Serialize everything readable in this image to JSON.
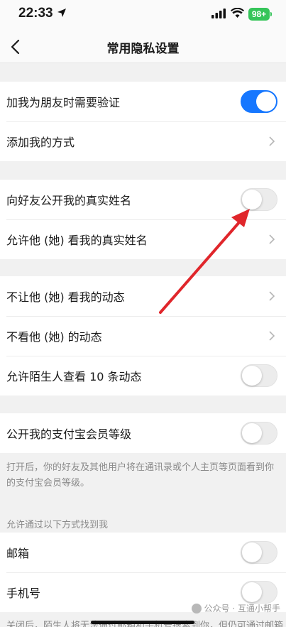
{
  "status_bar": {
    "time": "22:33",
    "battery": "98+"
  },
  "header": {
    "title": "常用隐私设置"
  },
  "groups": [
    {
      "rows": [
        {
          "label": "加我为朋友时需要验证",
          "control": "toggle",
          "on": true
        },
        {
          "label": "添加我的方式",
          "control": "chevron"
        }
      ]
    },
    {
      "rows": [
        {
          "label": "向好友公开我的真实姓名",
          "control": "toggle",
          "on": false
        },
        {
          "label": "允许他 (她) 看我的真实姓名",
          "control": "chevron"
        }
      ]
    },
    {
      "rows": [
        {
          "label": "不让他 (她) 看我的动态",
          "control": "chevron"
        },
        {
          "label": "不看他 (她) 的动态",
          "control": "chevron"
        },
        {
          "label": "允许陌生人查看 10 条动态",
          "control": "toggle",
          "on": false
        }
      ]
    },
    {
      "rows": [
        {
          "label": "公开我的支付宝会员等级",
          "control": "toggle",
          "on": false
        }
      ]
    }
  ],
  "membership_note": "打开后，你的好友及其他用户将在通讯录或个人主页等页面看到你的支付宝会员等级。",
  "find_me": {
    "header": "允许通过以下方式找到我",
    "rows": [
      {
        "label": "邮箱",
        "control": "toggle",
        "on": false
      },
      {
        "label": "手机号",
        "control": "toggle",
        "on": false
      }
    ]
  },
  "watermark": "公众号 · 互通小帮手",
  "bottom_text": "关闭后，陌生人将无法通过邮箱和手机号搜索到你，但仍可通过邮箱上",
  "colors": {
    "accent": "#1677ff",
    "annotation_arrow": "#e0262b",
    "battery": "#36c55a"
  },
  "icons": [
    "location-arrow-icon",
    "signal-icon",
    "wifi-icon",
    "back-chevron-icon",
    "chevron-right-icon"
  ]
}
